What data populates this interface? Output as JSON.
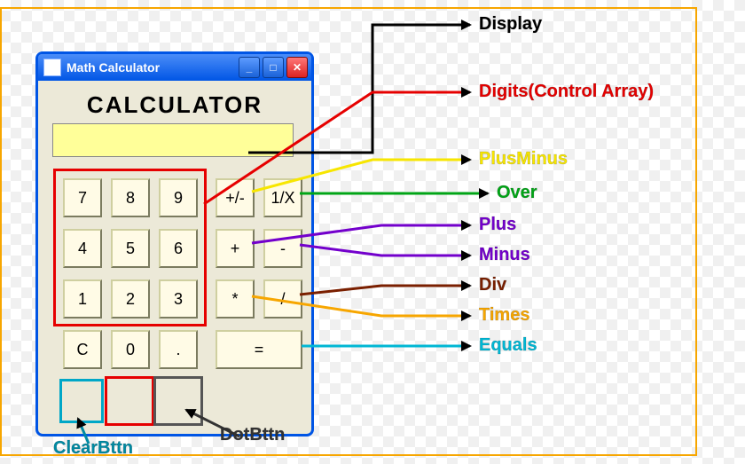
{
  "window": {
    "title": "Math Calculator",
    "heading": "CALCULATOR"
  },
  "display_value": "",
  "keys": {
    "digits": {
      "7": "7",
      "8": "8",
      "9": "9",
      "4": "4",
      "5": "5",
      "6": "6",
      "1": "1",
      "2": "2",
      "3": "3",
      "0": "0"
    },
    "clear": "C",
    "dot": ".",
    "plusminus": "+/-",
    "over": "1/X",
    "plus": "+",
    "minus": "-",
    "times": "*",
    "div": "/",
    "equals": "="
  },
  "labels": {
    "display": "Display",
    "digits": "Digits(Control Array)",
    "plusminus": "PlusMinus",
    "over": "Over",
    "plus": "Plus",
    "minus": "Minus",
    "div": "Div",
    "times": "Times",
    "equals": "Equals",
    "clear": "ClearBttn",
    "dot": "DotBttn"
  },
  "palette": {
    "accent": "#0055e5",
    "display_bg": "#ffff99",
    "highlight_red": "#e60000",
    "arrow_display": "#000000",
    "arrow_digits": "#e60000",
    "arrow_plusminus": "#f7e600",
    "arrow_over": "#00a516",
    "arrow_plus": "#7300cc",
    "arrow_minus": "#7300cc",
    "arrow_div": "#7a1f00",
    "arrow_times": "#f7a600",
    "arrow_equals": "#00b7d4",
    "arrow_clear": "#008aa3",
    "arrow_dot": "#333333",
    "border": "#f7a600"
  }
}
